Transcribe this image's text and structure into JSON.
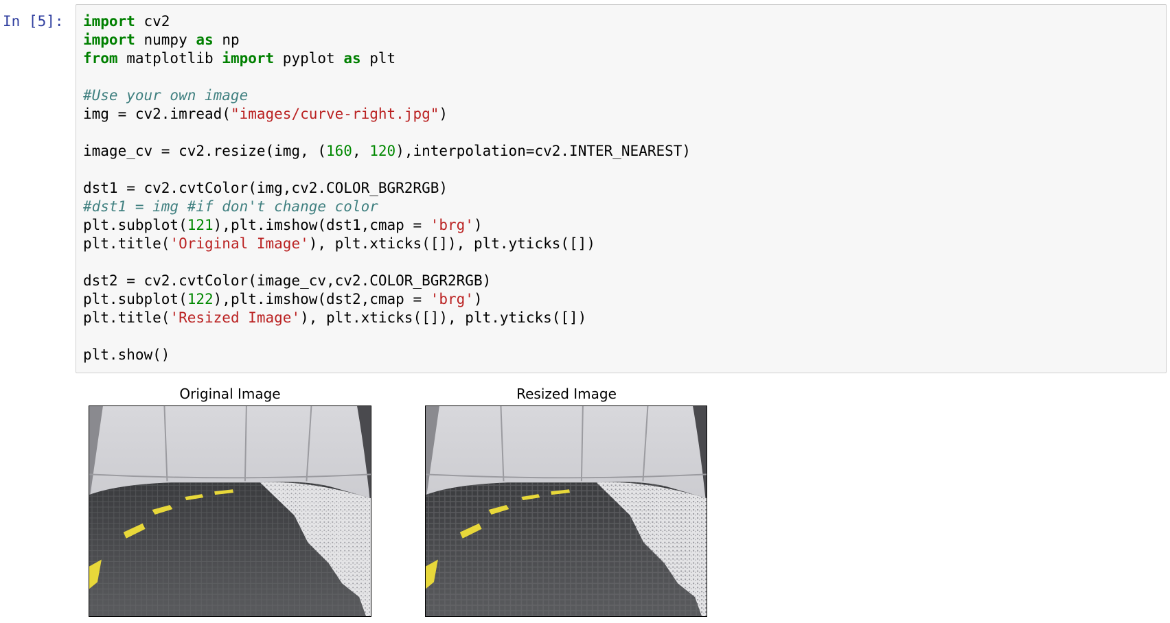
{
  "cell": {
    "prompt": "In [5]:",
    "lines": [
      [
        {
          "t": "import",
          "c": "kw"
        },
        {
          "t": " cv2",
          "c": ""
        }
      ],
      [
        {
          "t": "import",
          "c": "kw"
        },
        {
          "t": " numpy ",
          "c": ""
        },
        {
          "t": "as",
          "c": "kw"
        },
        {
          "t": " np",
          "c": ""
        }
      ],
      [
        {
          "t": "from",
          "c": "kw"
        },
        {
          "t": " matplotlib ",
          "c": ""
        },
        {
          "t": "import",
          "c": "kw"
        },
        {
          "t": " pyplot ",
          "c": ""
        },
        {
          "t": "as",
          "c": "kw"
        },
        {
          "t": " plt",
          "c": ""
        }
      ],
      [],
      [
        {
          "t": "#Use your own image",
          "c": "cm"
        }
      ],
      [
        {
          "t": "img = cv2.imread(",
          "c": ""
        },
        {
          "t": "\"images/curve-right.jpg\"",
          "c": "st"
        },
        {
          "t": ")",
          "c": ""
        }
      ],
      [],
      [
        {
          "t": "image_cv = cv2.resize(img, (",
          "c": ""
        },
        {
          "t": "160",
          "c": "nm"
        },
        {
          "t": ", ",
          "c": ""
        },
        {
          "t": "120",
          "c": "nm"
        },
        {
          "t": "),interpolation=cv2.INTER_NEAREST)",
          "c": ""
        }
      ],
      [],
      [
        {
          "t": "dst1 = cv2.cvtColor(img,cv2.COLOR_BGR2RGB)",
          "c": ""
        }
      ],
      [
        {
          "t": "#dst1 = img #if don't change color",
          "c": "cm"
        }
      ],
      [
        {
          "t": "plt.subplot(",
          "c": ""
        },
        {
          "t": "121",
          "c": "nm"
        },
        {
          "t": "),plt.imshow(dst1,cmap = ",
          "c": ""
        },
        {
          "t": "'brg'",
          "c": "st"
        },
        {
          "t": ")",
          "c": ""
        }
      ],
      [
        {
          "t": "plt.title(",
          "c": ""
        },
        {
          "t": "'Original Image'",
          "c": "st"
        },
        {
          "t": "), plt.xticks([]), plt.yticks([])",
          "c": ""
        }
      ],
      [],
      [
        {
          "t": "dst2 = cv2.cvtColor(image_cv,cv2.COLOR_BGR2RGB)",
          "c": ""
        }
      ],
      [
        {
          "t": "plt.subplot(",
          "c": ""
        },
        {
          "t": "122",
          "c": "nm"
        },
        {
          "t": "),plt.imshow(dst2,cmap = ",
          "c": ""
        },
        {
          "t": "'brg'",
          "c": "st"
        },
        {
          "t": ")",
          "c": ""
        }
      ],
      [
        {
          "t": "plt.title(",
          "c": ""
        },
        {
          "t": "'Resized Image'",
          "c": "st"
        },
        {
          "t": "), plt.xticks([]), plt.yticks([])",
          "c": ""
        }
      ],
      [],
      [
        {
          "t": "plt.show()",
          "c": ""
        }
      ]
    ]
  },
  "output": {
    "plots": [
      {
        "title": "Original Image",
        "image": "fisheye-track-photo-original"
      },
      {
        "title": "Resized Image",
        "image": "fisheye-track-photo-resized"
      }
    ]
  },
  "colors": {
    "prompt": "#303f9f",
    "keyword": "#008000",
    "comment": "#408080",
    "string": "#ba2121",
    "number": "#008800",
    "cell_background": "#f7f7f7",
    "lane_marking": "#e8d83a"
  }
}
